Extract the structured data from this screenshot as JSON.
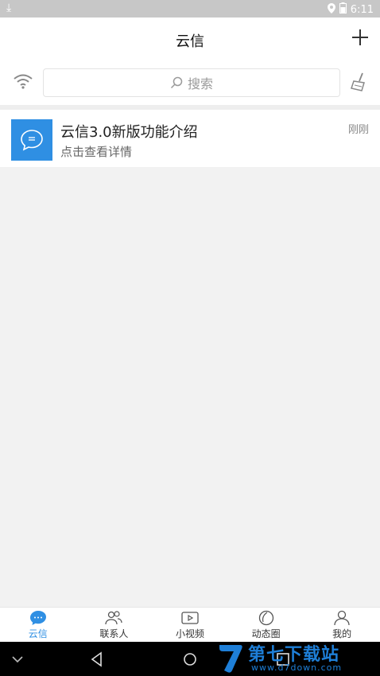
{
  "status_bar": {
    "time": "6:11"
  },
  "header": {
    "title": "云信"
  },
  "search": {
    "placeholder": "搜索"
  },
  "conversations": [
    {
      "title": "云信3.0新版功能介绍",
      "subtitle": "点击查看详情",
      "time": "刚刚"
    }
  ],
  "tabs": [
    {
      "label": "云信",
      "icon": "chat-bubble-icon",
      "active": true
    },
    {
      "label": "联系人",
      "icon": "contacts-icon",
      "active": false
    },
    {
      "label": "小视频",
      "icon": "video-icon",
      "active": false
    },
    {
      "label": "动态圈",
      "icon": "moments-icon",
      "active": false
    },
    {
      "label": "我的",
      "icon": "profile-icon",
      "active": false
    }
  ],
  "watermark": {
    "name": "第七下载站",
    "url": "www.d7down.com"
  },
  "colors": {
    "accent": "#2f8fe3",
    "status_bar": "#c7c7c7"
  }
}
